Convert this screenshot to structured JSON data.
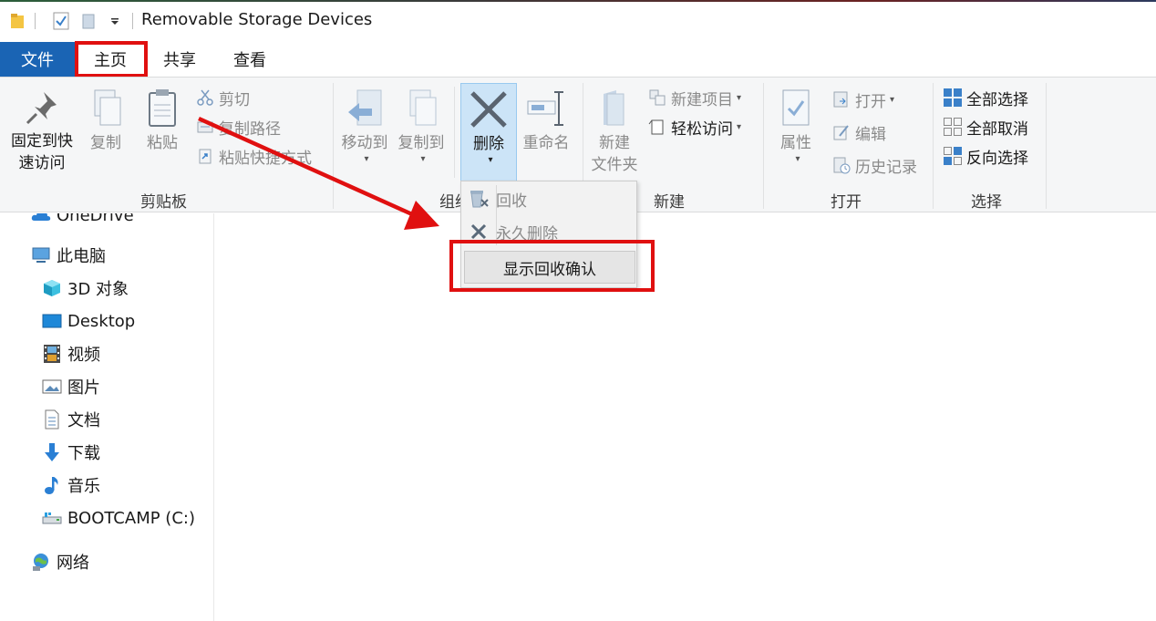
{
  "window": {
    "title": "Removable Storage Devices"
  },
  "tabs": {
    "file": "文件",
    "home": "主页",
    "share": "共享",
    "view": "查看"
  },
  "ribbon": {
    "clipboard": {
      "label": "剪贴板",
      "pin_line1": "固定到快",
      "pin_line2": "速访问",
      "copy": "复制",
      "paste": "粘贴",
      "cut": "剪切",
      "copy_path": "复制路径",
      "paste_shortcut": "粘贴快捷方式"
    },
    "organize": {
      "label": "组织",
      "move_to": "移动到",
      "copy_to": "复制到",
      "delete": "删除",
      "rename": "重命名"
    },
    "new": {
      "label": "新建",
      "new_folder_line1": "新建",
      "new_folder_line2": "文件夹",
      "new_item": "新建项目",
      "easy_access": "轻松访问"
    },
    "open": {
      "label": "打开",
      "properties": "属性",
      "open": "打开",
      "edit": "编辑",
      "history": "历史记录"
    },
    "select": {
      "label": "选择",
      "select_all": "全部选择",
      "select_none": "全部取消",
      "invert": "反向选择"
    }
  },
  "delete_menu": {
    "recycle": "回收",
    "permanent": "永久删除",
    "show_confirm": "显示回收确认"
  },
  "nav": {
    "onedrive": "OneDrive",
    "this_pc": "此电脑",
    "objects3d": "3D 对象",
    "desktop": "Desktop",
    "videos": "视频",
    "pictures": "图片",
    "documents": "文档",
    "downloads": "下载",
    "music": "音乐",
    "bootcamp": "BOOTCAMP (C:)",
    "network": "网络"
  },
  "colors": {
    "accent": "#1a64b4",
    "annotation": "#e01010",
    "selected": "#cce4f7"
  }
}
